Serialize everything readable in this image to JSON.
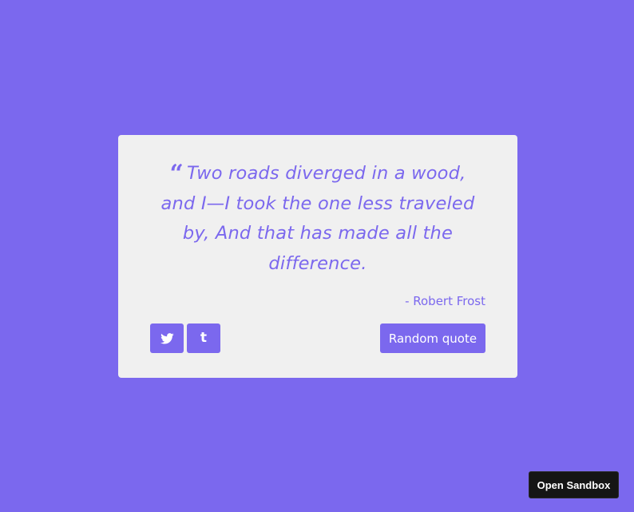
{
  "quote": {
    "mark": "“",
    "text": "Two roads diverged in a wood, and I—I took the one less traveled by, And that has made all the difference.",
    "author": "- Robert Frost"
  },
  "actions": {
    "tweet_icon": "twitter-icon",
    "tumblr_icon": "tumblr-icon",
    "tumblr_glyph": "t",
    "random_label": "Random quote"
  },
  "sandbox": {
    "label": "Open Sandbox"
  },
  "colors": {
    "background": "#7b68ee",
    "card": "#f0f0f0",
    "accent": "#7b68ee",
    "sandbox": "#151515"
  }
}
